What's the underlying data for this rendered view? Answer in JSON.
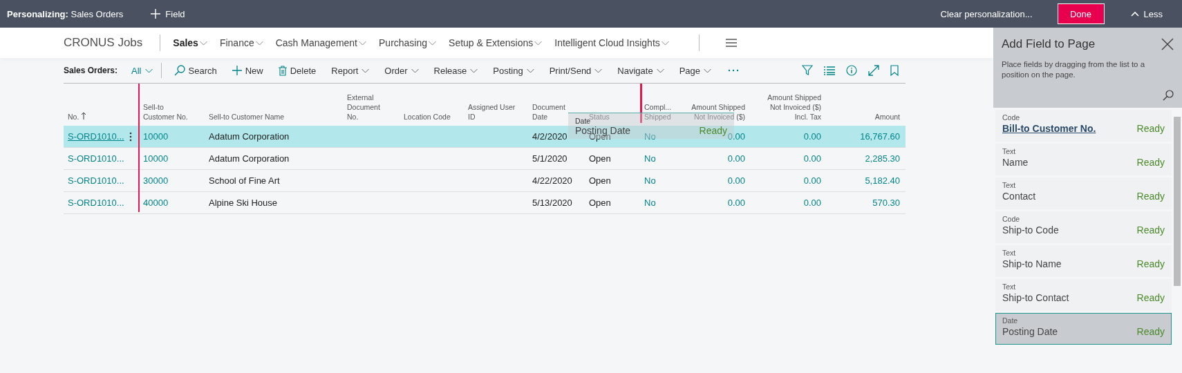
{
  "personalize_bar": {
    "title": "**Personalizing:** Sales Orders",
    "add_field": "Field",
    "clear": "Clear personalization...",
    "done": "Done",
    "less": "Less"
  },
  "nav": {
    "company": "CRONUS Jobs",
    "items": [
      {
        "label": "Sales",
        "selected": true
      },
      {
        "label": "Finance",
        "selected": false
      },
      {
        "label": "Cash Management",
        "selected": false
      },
      {
        "label": "Purchasing",
        "selected": false
      },
      {
        "label": "Setup & Extensions",
        "selected": false
      },
      {
        "label": "Intelligent Cloud Insights",
        "selected": false
      }
    ]
  },
  "action_bar": {
    "page_caption": "Sales Orders:",
    "view": "All",
    "actions": [
      {
        "kind": "search",
        "label": "Search"
      },
      {
        "kind": "new",
        "label": "New"
      },
      {
        "kind": "delete",
        "label": "Delete"
      },
      {
        "kind": "menu",
        "label": "Report"
      },
      {
        "kind": "menu",
        "label": "Order"
      },
      {
        "kind": "menu",
        "label": "Release"
      },
      {
        "kind": "menu",
        "label": "Posting"
      },
      {
        "kind": "menu",
        "label": "Print/Send"
      },
      {
        "kind": "menu",
        "label": "Navigate"
      },
      {
        "kind": "menu",
        "label": "Page"
      }
    ]
  },
  "table": {
    "columns": [
      {
        "label": "No.",
        "kind": "link",
        "sorted": true
      },
      {
        "label": "Sell-to\nCustomer No.",
        "kind": "link",
        "sorted": false
      },
      {
        "label": "Sell-to Customer Name",
        "kind": "text",
        "sorted": false
      },
      {
        "label": "External\nDocument\nNo.",
        "kind": "text",
        "sorted": false
      },
      {
        "label": "Location Code",
        "kind": "text",
        "sorted": false
      },
      {
        "label": "Assigned User\nID",
        "kind": "text",
        "sorted": false
      },
      {
        "label": "Document\nDate",
        "kind": "text",
        "sorted": false
      },
      {
        "label": "Status",
        "kind": "text",
        "sorted": false
      },
      {
        "label": "Compl...\nShipped",
        "kind": "flag",
        "sorted": false
      },
      {
        "label": "Amount Shipped\nNot Invoiced ($)",
        "kind": "amount",
        "sorted": false
      },
      {
        "label": "Amount Shipped\nNot Invoiced ($)\nIncl. Tax",
        "kind": "amount",
        "sorted": false
      },
      {
        "label": "Amount",
        "kind": "amount",
        "sorted": false
      }
    ],
    "rows": [
      {
        "selected": true,
        "cells": [
          "S-ORD1010...",
          "10000",
          "Adatum Corporation",
          null,
          null,
          null,
          "4/2/2020",
          "Open",
          "No",
          "0.00",
          "0.00",
          "16,767.60"
        ]
      },
      {
        "selected": false,
        "cells": [
          "S-ORD1010...",
          "10000",
          "Adatum Corporation",
          null,
          null,
          null,
          "5/1/2020",
          "Open",
          "No",
          "0.00",
          "0.00",
          "2,285.30"
        ]
      },
      {
        "selected": false,
        "cells": [
          "S-ORD1010...",
          "30000",
          "School of Fine Art",
          null,
          null,
          null,
          "4/22/2020",
          "Open",
          "No",
          "0.00",
          "0.00",
          "5,182.40"
        ]
      },
      {
        "selected": false,
        "cells": [
          "S-ORD1010...",
          "40000",
          "Alpine Ski House",
          null,
          null,
          null,
          "5/13/2020",
          "Open",
          "No",
          "0.00",
          "0.00",
          "570.30"
        ]
      }
    ],
    "drag_preview": {
      "type": "Date",
      "name": "Posting Date",
      "status": "Ready"
    }
  },
  "panel": {
    "title": "Add Field to Page",
    "description": "Place fields by dragging from the list to a position on the page.",
    "fields": [
      {
        "type": "Code",
        "name": "Bill-to Customer No.",
        "status": "Ready",
        "focused": true,
        "selected": false
      },
      {
        "type": "Text",
        "name": "Name",
        "status": "Ready",
        "focused": false,
        "selected": false
      },
      {
        "type": "Text",
        "name": "Contact",
        "status": "Ready",
        "focused": false,
        "selected": false
      },
      {
        "type": "Code",
        "name": "Ship-to Code",
        "status": "Ready",
        "focused": false,
        "selected": false
      },
      {
        "type": "Text",
        "name": "Ship-to Name",
        "status": "Ready",
        "focused": false,
        "selected": false
      },
      {
        "type": "Text",
        "name": "Ship-to Contact",
        "status": "Ready",
        "focused": false,
        "selected": false
      },
      {
        "type": "Date",
        "name": "Posting Date",
        "status": "Ready",
        "focused": false,
        "selected": true
      }
    ]
  }
}
